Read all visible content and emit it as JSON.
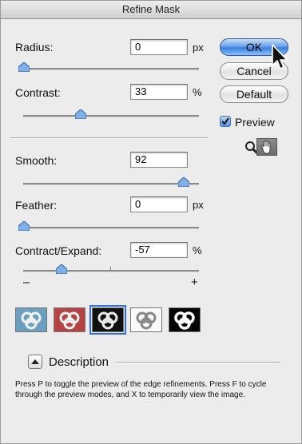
{
  "window": {
    "title": "Refine Mask"
  },
  "radius": {
    "label": "Radius:",
    "value": "0",
    "unit": "px",
    "slider_fraction": 0.0
  },
  "contrast": {
    "label": "Contrast:",
    "value": "33",
    "unit": "%",
    "slider_fraction": 0.33
  },
  "smooth": {
    "label": "Smooth:",
    "value": "92",
    "slider_fraction": 0.92
  },
  "feather": {
    "label": "Feather:",
    "value": "0",
    "unit": "px",
    "slider_fraction": 0.0
  },
  "contract_expand": {
    "label": "Contract/Expand:",
    "value": "-57",
    "unit": "%",
    "slider_value": -57,
    "min_symbol": "–",
    "max_symbol": "+"
  },
  "buttons": {
    "ok": "OK",
    "cancel": "Cancel",
    "default": "Default"
  },
  "preview": {
    "label": "Preview",
    "checked": true
  },
  "tools": {
    "zoom_icon": "magnifier-icon",
    "hand_icon": "hand-icon",
    "selected": "hand"
  },
  "preview_modes": {
    "count": 5,
    "selected_index": 2,
    "names": [
      "standard-mode-icon",
      "quick-mask-mode-icon",
      "black-background-mode-icon",
      "white-background-mode-icon",
      "mask-mode-icon"
    ]
  },
  "description": {
    "label": "Description",
    "text": "Press P to toggle the preview of the edge refinements. Press F to cycle through the preview modes, and X to temporarily view the image."
  },
  "colors": {
    "accent": "#3a7fdd",
    "window_bg": "#ececec"
  }
}
